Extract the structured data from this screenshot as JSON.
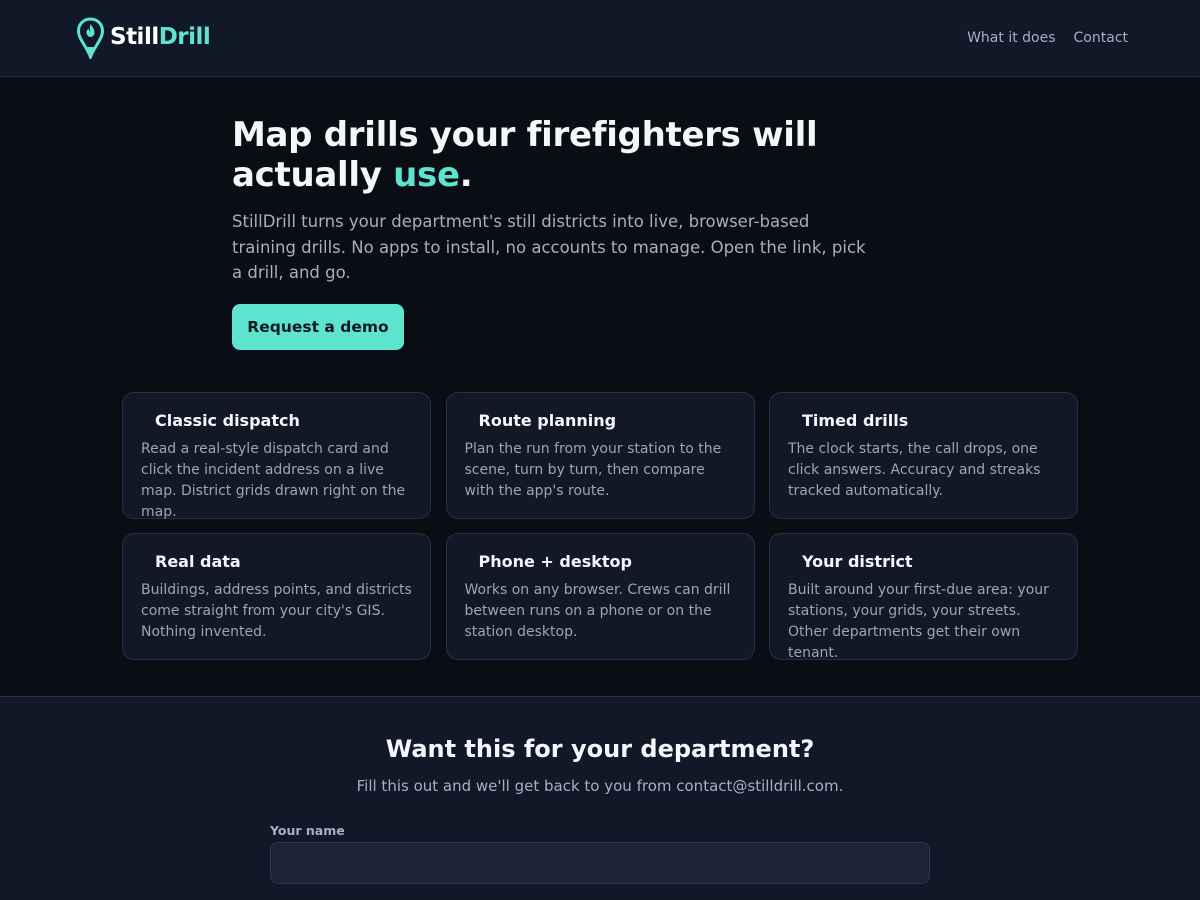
{
  "brand": {
    "name_part1": "Still",
    "name_part2": "Drill",
    "accent": "#5ee3cf",
    "logo_icon": "map-pin-flame-icon"
  },
  "nav": {
    "items": [
      {
        "label": "What it does"
      },
      {
        "label": "Contact"
      }
    ]
  },
  "hero": {
    "title_main": "Map drills your firefighters will actually",
    "title_accent": "use",
    "title_end": ".",
    "description": "StillDrill turns your department's still districts into live, browser-based training drills. No apps to install, no accounts to manage. Open the link, pick a drill, and go.",
    "cta_label": "Request a demo"
  },
  "features": [
    {
      "title": "Classic dispatch",
      "text": "Read a real-style dispatch card and click the incident address on a live map. District grids drawn right on the map."
    },
    {
      "title": "Route planning",
      "text": "Plan the run from your station to the scene, turn by turn, then compare with the app's route."
    },
    {
      "title": "Timed drills",
      "text": "The clock starts, the call drops, one click answers. Accuracy and streaks tracked automatically."
    },
    {
      "title": "Real data",
      "text": "Buildings, address points, and districts come straight from your city's GIS. Nothing invented."
    },
    {
      "title": "Phone + desktop",
      "text": "Works on any browser. Crews can drill between runs on a phone or on the station desktop."
    },
    {
      "title": "Your district",
      "text": "Built around your first-due area: your stations, your grids, your streets. Other departments get their own tenant."
    }
  ],
  "contact": {
    "heading": "Want this for your department?",
    "subtext": "Fill this out and we'll get back to you from contact@stilldrill.com.",
    "name_label": "Your name",
    "name_value": ""
  }
}
